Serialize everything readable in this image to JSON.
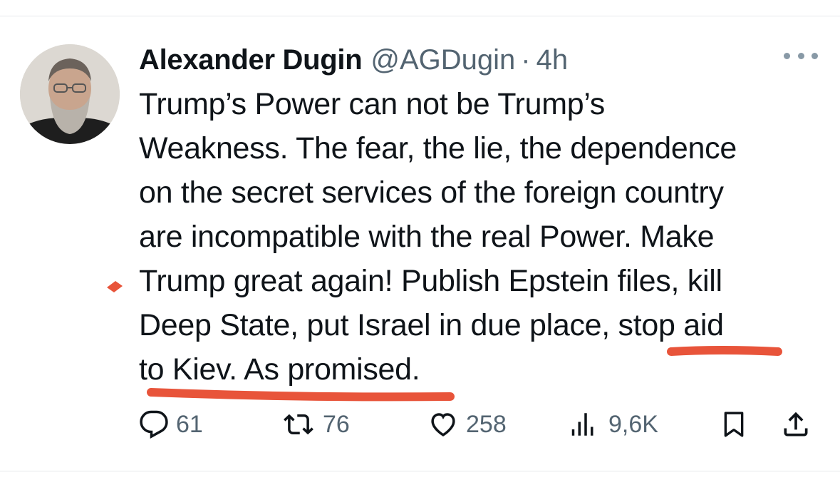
{
  "tweet": {
    "author_name": "Alexander Dugin",
    "handle": "@AGDugin",
    "separator": "·",
    "time": "4h",
    "text_lines": [
      "Trump’s Power can not be Trump’s",
      "Weakness. The fear, the lie, the dependence",
      "on the secret services of the foreign country",
      "are incompatible with the real Power. Make",
      "Trump great again! Publish Epstein files, kill",
      "Deep State, put Israel in due place, stop aid",
      "to Kiev. As promised."
    ]
  },
  "actions": {
    "replies": "61",
    "reposts": "76",
    "likes": "258",
    "views": "9,6K"
  },
  "icons": {
    "avatar": "avatar",
    "more": "more-icon",
    "reply": "reply-icon",
    "repost": "repost-icon",
    "like": "heart-icon",
    "views": "views-icon",
    "bookmark": "bookmark-icon",
    "share": "share-icon"
  },
  "colors": {
    "text": "#0f1419",
    "secondary": "#536471",
    "annotation": "#e8543a"
  }
}
